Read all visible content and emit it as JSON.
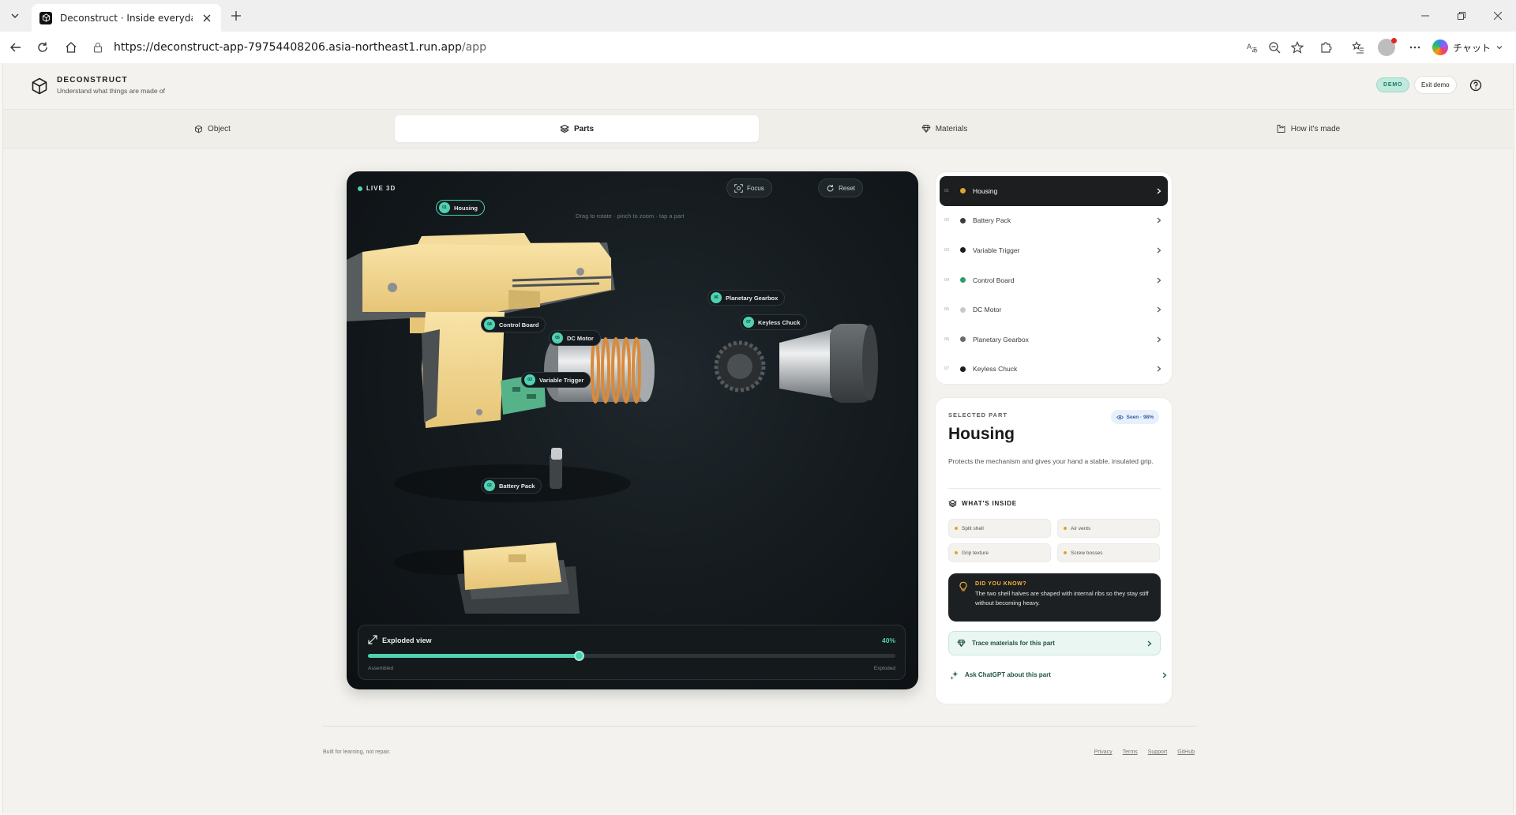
{
  "browser": {
    "tab_title": "Deconstruct · Inside everyday things",
    "url_host": "https://deconstruct-app-79754408206.asia-northeast1.run.app",
    "url_path": "/app",
    "copilot_label": "チャット"
  },
  "app": {
    "brand_name": "DECONSTRUCT",
    "brand_tagline": "Understand what things are made of",
    "demo_badge": "DEMO",
    "exit_demo": "Exit demo"
  },
  "nav": {
    "tabs": [
      {
        "label": "Object",
        "icon": "cube-icon",
        "active": false
      },
      {
        "label": "Parts",
        "icon": "layers-icon",
        "active": true
      },
      {
        "label": "Materials",
        "icon": "gem-icon",
        "active": false
      },
      {
        "label": "How it's made",
        "icon": "factory-icon",
        "active": false
      }
    ]
  },
  "viewer": {
    "live_label": "LIVE 3D",
    "hint": "Drag to rotate · pinch to zoom · tap a part",
    "focus_label": "Focus",
    "reset_label": "Reset",
    "labels": [
      {
        "num": "01",
        "name": "Housing",
        "selected": true
      },
      {
        "num": "02",
        "name": "Battery Pack"
      },
      {
        "num": "03",
        "name": "Variable Trigger"
      },
      {
        "num": "04",
        "name": "Control Board"
      },
      {
        "num": "05",
        "name": "DC Motor"
      },
      {
        "num": "06",
        "name": "Planetary Gearbox"
      },
      {
        "num": "07",
        "name": "Keyless Chuck"
      }
    ],
    "exploded": {
      "title": "Exploded view",
      "value": 0.4,
      "value_label": "40%",
      "min_label": "Assembled",
      "max_label": "Exploded"
    }
  },
  "parts_list": [
    {
      "num": "01",
      "label": "Housing",
      "dot": "#e0a52e",
      "active": true
    },
    {
      "num": "02",
      "label": "Battery Pack",
      "dot": "#3a3a36"
    },
    {
      "num": "03",
      "label": "Variable Trigger",
      "dot": "#1c1c1a"
    },
    {
      "num": "04",
      "label": "Control Board",
      "dot": "#2f9a6a"
    },
    {
      "num": "05",
      "label": "DC Motor",
      "dot": "#c9c9c4"
    },
    {
      "num": "06",
      "label": "Planetary Gearbox",
      "dot": "#6a6a66"
    },
    {
      "num": "07",
      "label": "Keyless Chuck",
      "dot": "#1c1c1a"
    }
  ],
  "selected_part": {
    "eyebrow": "SELECTED PART",
    "seen_label": "Seen · 98%",
    "title": "Housing",
    "description": "Protects the mechanism and gives your hand a stable, insulated grip.",
    "inside_title": "WHAT'S INSIDE",
    "inside_items": [
      "Split shell",
      "Air vents",
      "Grip texture",
      "Screw bosses"
    ],
    "did_you_know_title": "DID YOU KNOW?",
    "did_you_know_text": "The two shell halves are shaped with internal ribs so they stay stiff without becoming heavy.",
    "trace_label": "Trace materials for this part",
    "ask_label": "Ask ChatGPT about this part"
  },
  "footer": {
    "note": "Built for learning, not repair.",
    "links": [
      "Privacy",
      "Terms",
      "Support",
      "GitHub"
    ]
  },
  "colors": {
    "accent": "#4fd1b2",
    "highlight": "#e0a52e",
    "dark": "#1c1e1f"
  }
}
